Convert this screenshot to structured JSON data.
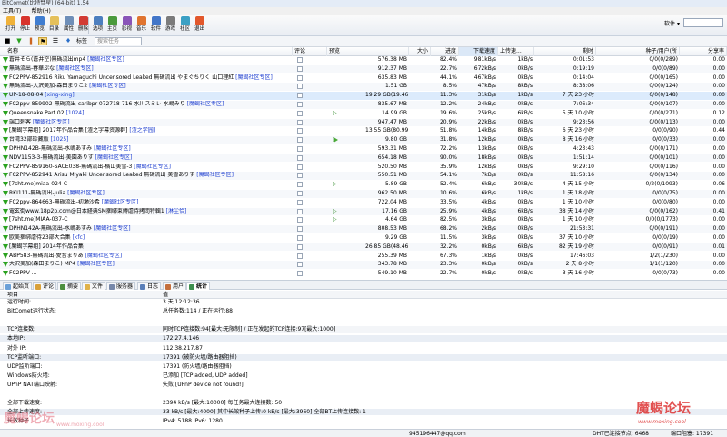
{
  "window": {
    "title": "BitComet(比特彗星) (64-bit) 1.54"
  },
  "menu": [
    "工具(T)",
    "帮助(H)"
  ],
  "toolbar": {
    "buttons": [
      {
        "label": "打开",
        "icon": "open-folder-icon",
        "color": "#f0b23a"
      },
      {
        "label": "停止",
        "icon": "stop-icon",
        "color": "#d8342c"
      },
      {
        "label": "预览",
        "icon": "preview-icon",
        "color": "#3f7dd0"
      },
      {
        "label": "目录",
        "icon": "folder-icon",
        "color": "#e5c05a"
      },
      {
        "label": "属性",
        "icon": "properties-icon",
        "color": "#6f8fb8"
      },
      {
        "label": "删除",
        "icon": "delete-icon",
        "color": "#d23b33"
      },
      {
        "label": "选项",
        "icon": "options-icon",
        "color": "#4d7fbf"
      },
      {
        "label": "主页",
        "icon": "home-icon",
        "color": "#4b9a3c"
      },
      {
        "label": "影视",
        "icon": "video-icon",
        "color": "#8a55b8"
      },
      {
        "label": "音乐",
        "icon": "music-icon",
        "color": "#e0742f"
      },
      {
        "label": "软件",
        "icon": "software-icon",
        "color": "#4376c8"
      },
      {
        "label": "游戏",
        "icon": "game-icon",
        "color": "#7b7b7b"
      },
      {
        "label": "社区",
        "icon": "community-icon",
        "color": "#3ba0c4"
      },
      {
        "label": "退出",
        "icon": "exit-icon",
        "color": "#e2572b"
      }
    ],
    "software_label": "软件"
  },
  "toolbar2": {
    "tag_label": "标签",
    "tag_placeholder": "搜索任务"
  },
  "columns": {
    "name": "名称",
    "comment": "评论",
    "preview": "预览",
    "size": "大小",
    "progress": "进度",
    "down": "下载速度",
    "up": "上传速...",
    "remaining": "剩时",
    "seeds": "种子/用户(所",
    "ratio": "分享率"
  },
  "rows": [
    {
      "name": "蒼井そら(蒼井空)無碼流出mp4",
      "tag": "[魔蝎社区专区]",
      "size": "576.38 MB",
      "prog": "82.4%",
      "down": "981kB/s",
      "up": "1kB/s",
      "rem": "0:01:53",
      "seeds": "0/0(0/289)",
      "ratio": "0.00"
    },
    {
      "name": "無碼流出-春華ぷな",
      "tag": "[魔蝎社区专区]",
      "size": "912.37 MB",
      "prog": "22.7%",
      "down": "672kB/s",
      "up": "0kB/s",
      "rem": "0:19:19",
      "seeds": "0/0(0/89)",
      "ratio": "0.00"
    },
    {
      "name": "FC2PPV-852916 Riku Yamaguchi Uncensored Leaked 無碼流出 やまぐちりく 山口理紅",
      "tag": "[魔蝎社区专区]",
      "size": "635.83 MB",
      "prog": "44.1%",
      "down": "467kB/s",
      "up": "0kB/s",
      "rem": "0:14:04",
      "seeds": "0/0(0/165)",
      "ratio": "0.00"
    },
    {
      "name": "無碼流出-大沢美加-森田まりこ2",
      "tag": "[魔蝎社区专区]",
      "size": "1.51 GB",
      "prog": "8.5%",
      "down": "47kB/s",
      "up": "8kB/s",
      "rem": "8:38:06",
      "seeds": "0/0(0/124)",
      "ratio": "0.00"
    },
    {
      "name": "UP-18-08-04",
      "tag": "[xing-xing]",
      "size": "19.29 GB(19.46 GB)",
      "prog": "11.3%",
      "down": "31kB/s",
      "up": "1kB/s",
      "rem": "7 天 23 小时",
      "seeds": "0/0(0/148)",
      "ratio": "0.00"
    },
    {
      "name": "FC2ppv-859902-無碼流出-caribpr-072718-716-水川スミレ-水嶋みり",
      "tag": "[魔蝎社区专区]",
      "size": "835.67 MB",
      "prog": "12.2%",
      "down": "24kB/s",
      "up": "0kB/s",
      "rem": "7:06:34",
      "seeds": "0/0(0/107)",
      "ratio": "0.00"
    },
    {
      "name": "Queensnake Part 02",
      "tag": "[1024]",
      "size": "14.99 GB",
      "prog": "19.6%",
      "down": "25kB/s",
      "up": "6kB/s",
      "rem": "5 天 10 小时",
      "seeds": "0/0(0/271)",
      "ratio": "0.12",
      "preview": true
    },
    {
      "name": "端口刺客",
      "tag": "[魔蝎社区专区]",
      "size": "947.47 MB",
      "prog": "20.9%",
      "down": "22kB/s",
      "up": "0kB/s",
      "rem": "9:23:56",
      "seeds": "0/0(0/113)",
      "ratio": "0.00"
    },
    {
      "name": "[魔蝎字幕组] 2017年作品合集 [渣之字幕资源群]",
      "tag": "[渣之学园]",
      "size": "13.55 GB(80.99 GB)",
      "prog": "51.8%",
      "down": "14kB/s",
      "up": "8kB/s",
      "rem": "6 天 23 小时",
      "seeds": "0/0(0/90)",
      "ratio": "0.44"
    },
    {
      "name": "台湾32部珍藏版",
      "tag": "[1025]",
      "size": "9.80 GB",
      "prog": "31.8%",
      "down": "12kB/s",
      "up": "0kB/s",
      "rem": "8 天 16 小时",
      "seeds": "0/0(0/33)",
      "ratio": "0.00",
      "preview": true,
      "play": true
    },
    {
      "name": "DPHN142B-無碼流出-水嶋あずみ",
      "tag": "[魔蝎社区专区]",
      "size": "593.31 MB",
      "prog": "72.2%",
      "down": "13kB/s",
      "up": "0kB/s",
      "rem": "4:23:43",
      "seeds": "0/0(0/171)",
      "ratio": "0.00"
    },
    {
      "name": "NDV1153-3-無碼流出-美園ありす",
      "tag": "[魔蝎社区专区]",
      "size": "654.18 MB",
      "prog": "90.0%",
      "down": "18kB/s",
      "up": "0kB/s",
      "rem": "1:51:14",
      "seeds": "0/0(0/101)",
      "ratio": "0.00"
    },
    {
      "name": "FC2PPV-859160-SACE038-無碼流出-橘山美雪-3",
      "tag": "[魔蝎社区专区]",
      "size": "520.50 MB",
      "prog": "35.9%",
      "down": "12kB/s",
      "up": "0kB/s",
      "rem": "9:29:10",
      "seeds": "0/0(0/116)",
      "ratio": "0.00"
    },
    {
      "name": "FC2PPV-852941 Arisu Miyaki Uncensored Leaked 無碼流出 美雪ありす",
      "tag": "[魔蝎社区专区]",
      "size": "550.51 MB",
      "prog": "54.1%",
      "down": "7kB/s",
      "up": "0kB/s",
      "rem": "11:58:16",
      "seeds": "0/0(0/134)",
      "ratio": "0.00"
    },
    {
      "name": "[7sht.me]miaa-024-C",
      "tag": "",
      "size": "5.89 GB",
      "prog": "52.4%",
      "down": "6kB/s",
      "up": "30kB/s",
      "rem": "4 天 15 小时",
      "seeds": "0/2(0/1093)",
      "ratio": "0.06",
      "preview": true
    },
    {
      "name": "RKI111-無碼流出-Julia",
      "tag": "[魔蝎社区专区]",
      "size": "962.50 MB",
      "prog": "10.6%",
      "down": "6kB/s",
      "up": "1kB/s",
      "rem": "1 天 18 小时",
      "seeds": "0/0(0/75)",
      "ratio": "0.00"
    },
    {
      "name": "FC2ppv-864663-無碼流出-初瀬沙希",
      "tag": "[魔蝎社区专区]",
      "size": "722.04 MB",
      "prog": "33.5%",
      "down": "4kB/s",
      "up": "0kB/s",
      "rem": "1 天 10 小时",
      "seeds": "0/0(0/80)",
      "ratio": "0.00"
    },
    {
      "name": "電玄街www.18p2p.com@日本経典SM捆绑束縛虐待拷問特輯1",
      "tag": "[淋尘恰]",
      "size": "17.16 GB",
      "prog": "25.9%",
      "down": "4kB/s",
      "up": "6kB/s",
      "rem": "38 天 14 小时",
      "seeds": "0/0(0/162)",
      "ratio": "0.41",
      "preview": true
    },
    {
      "name": "[7sht.me]MIAA-037-C",
      "tag": "",
      "size": "4.64 GB",
      "prog": "82.5%",
      "down": "3kB/s",
      "up": "0kB/s",
      "rem": "1 天 10 小时",
      "seeds": "0/0(0/1773)",
      "ratio": "0.00",
      "preview": true
    },
    {
      "name": "DPHN142A-無碼流出-水嶋あずみ",
      "tag": "[魔蝎社区专区]",
      "size": "808.53 MB",
      "prog": "68.2%",
      "down": "2kB/s",
      "up": "0kB/s",
      "rem": "21:53:31",
      "seeds": "0/0(0/191)",
      "ratio": "0.00"
    },
    {
      "name": "欧美捆绑虐待23部大合集",
      "tag": "[kfc]",
      "size": "9.29 GB",
      "prog": "11.5%",
      "down": "3kB/s",
      "up": "0kB/s",
      "rem": "37 天 10 小时",
      "seeds": "0/0(0/19)",
      "ratio": "0.00"
    },
    {
      "name": "[魔蝎字幕组] 2014年作品合集",
      "tag": "",
      "size": "26.85 GB(48.46 GB)",
      "prog": "32.2%",
      "down": "0kB/s",
      "up": "6kB/s",
      "rem": "82 天 19 小时",
      "seeds": "0/0(0/91)",
      "ratio": "0.01"
    },
    {
      "name": "ABP583-無碼流出-愛音まりあ",
      "tag": "[魔蝎社区专区]",
      "size": "255.39 MB",
      "prog": "67.3%",
      "down": "1kB/s",
      "up": "0kB/s",
      "rem": "17:46:03",
      "seeds": "1/2(1/230)",
      "ratio": "0.00"
    },
    {
      "name": "大沢美加(森田まりこ) MP4",
      "tag": "[魔蝎社区专区]",
      "size": "343.78 MB",
      "prog": "23.3%",
      "down": "0kB/s",
      "up": "0kB/s",
      "rem": "2 天 8 小时",
      "seeds": "1/1(1/120)",
      "ratio": "0.00"
    },
    {
      "name": "FC2PPV-...",
      "tag": "",
      "size": "549.10 MB",
      "prog": "22.7%",
      "down": "0kB/s",
      "up": "0kB/s",
      "rem": "3 天 16 小时",
      "seeds": "0/0(0/73)",
      "ratio": "0.00"
    }
  ],
  "tabs": [
    "起始页",
    "评论",
    "摘要",
    "文件",
    "服务器",
    "日志",
    "用户",
    "统计"
  ],
  "props_head": {
    "key": "项目",
    "value": "值"
  },
  "props": [
    {
      "k": "运行时间:",
      "v": "3 天 12:12:36",
      "t": ""
    },
    {
      "k": "BitComet运行状态:",
      "v": "总任务数:114 / 正在运行:88",
      "t": ""
    },
    {
      "k": "",
      "v": "",
      "t": ""
    },
    {
      "k": "TCP连接数:",
      "v": "同时TCP连接数:94[最大:无限制] / 正在发起的TCP连接:97[最大:1000]",
      "t": "sec"
    },
    {
      "k": "本地IP:",
      "v": "172.27.4.146",
      "t": "shade"
    },
    {
      "k": "对外 IP:",
      "v": "112.38.217.87",
      "t": ""
    },
    {
      "k": "TCP监听端口:",
      "v": "17391 (被防火墙/路由器阻挡)",
      "t": "shade"
    },
    {
      "k": "UDP监听端口:",
      "v": "17391 (防火墙/路由器阻挡)",
      "t": ""
    },
    {
      "k": "Windows防火墙:",
      "v": "已添加 [TCP added, UDP added]",
      "t": ""
    },
    {
      "k": "UPnP NAT端口映射:",
      "v": "失败 [UPnP device not found!]",
      "t": ""
    },
    {
      "k": "",
      "v": "",
      "t": ""
    },
    {
      "k": "全部下载速度:",
      "v": "2394 kB/s [最大:10000]     每任务最大连接数: 50",
      "t": ""
    },
    {
      "k": "全部上传速度:",
      "v": "33 kB/s [最大:4000]     其中长效种子上传:0 kB/s [最大:3960]     全部BT上传连接数: 1",
      "t": "shade"
    },
    {
      "k": "长效种子...",
      "v": "IPv4: 5188   IPv6: 1280",
      "t": ""
    }
  ],
  "status": {
    "email": "945196447@qq.com",
    "dht": "DHT已连接节点: 6468",
    "port": "端口阻塞: 17391"
  },
  "watermark": {
    "main": "魔蝎论坛",
    "url": "www.moxing.cool"
  }
}
